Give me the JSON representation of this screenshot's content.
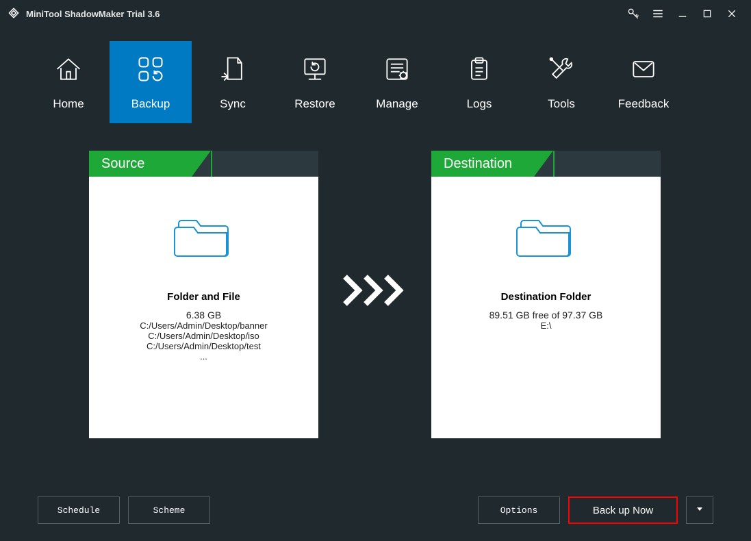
{
  "title": "MiniTool ShadowMaker Trial 3.6",
  "nav": {
    "items": [
      {
        "label": "Home"
      },
      {
        "label": "Backup"
      },
      {
        "label": "Sync"
      },
      {
        "label": "Restore"
      },
      {
        "label": "Manage"
      },
      {
        "label": "Logs"
      },
      {
        "label": "Tools"
      },
      {
        "label": "Feedback"
      }
    ],
    "active_index": 1
  },
  "source": {
    "header": "Source",
    "title": "Folder and File",
    "size": "6.38 GB",
    "paths": [
      "C:/Users/Admin/Desktop/banner",
      "C:/Users/Admin/Desktop/iso",
      "C:/Users/Admin/Desktop/test"
    ],
    "more": "..."
  },
  "destination": {
    "header": "Destination",
    "title": "Destination Folder",
    "free": "89.51 GB free of 97.37 GB",
    "path": "E:\\"
  },
  "footer": {
    "schedule": "Schedule",
    "scheme": "Scheme",
    "options": "Options",
    "backup_now": "Back up Now"
  }
}
